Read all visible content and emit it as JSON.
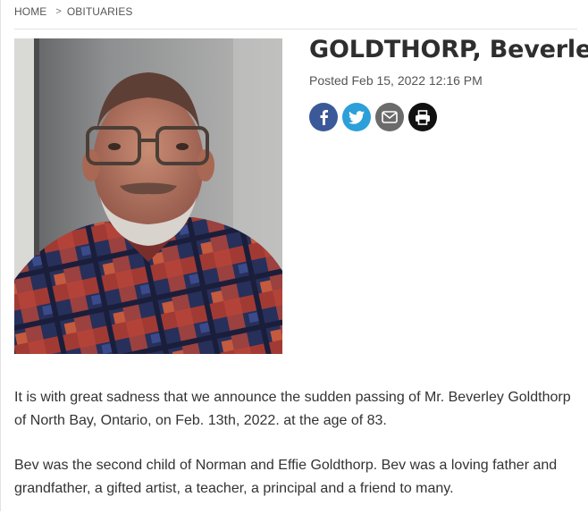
{
  "breadcrumb": {
    "home": "HOME",
    "separator": ">",
    "section": "OBITUARIES"
  },
  "article": {
    "title": "GOLDTHORP, Beverley",
    "posted": "Posted Feb 15, 2022 12:16 PM",
    "paragraphs": [
      "It is with great sadness that we announce the sudden passing of Mr. Beverley Goldthorp of North Bay, Ontario, on Feb. 13th, 2022.  at the age of 83.",
      "Bev was the second child of Norman and Effie Goldthorp. Bev was a loving father and grandfather, a gifted artist, a teacher, a principal and a friend to many."
    ]
  },
  "share": [
    {
      "name": "facebook",
      "icon": "facebook-icon",
      "color": "#3b5998"
    },
    {
      "name": "twitter",
      "icon": "twitter-icon",
      "color": "#2d9fd9"
    },
    {
      "name": "email",
      "icon": "envelope-icon",
      "color": "#6b6b6b"
    },
    {
      "name": "print",
      "icon": "printer-icon",
      "color": "#111111"
    }
  ]
}
